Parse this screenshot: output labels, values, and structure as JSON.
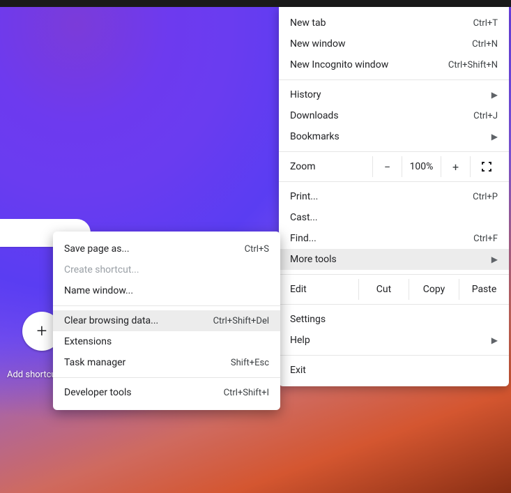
{
  "shortcut": {
    "plus": "+",
    "label": "Add shortcut"
  },
  "menu": {
    "new_tab": {
      "label": "New tab",
      "shortcut": "Ctrl+T"
    },
    "new_window": {
      "label": "New window",
      "shortcut": "Ctrl+N"
    },
    "new_incognito": {
      "label": "New Incognito window",
      "shortcut": "Ctrl+Shift+N"
    },
    "history": {
      "label": "History"
    },
    "downloads": {
      "label": "Downloads",
      "shortcut": "Ctrl+J"
    },
    "bookmarks": {
      "label": "Bookmarks"
    },
    "zoom_label": "Zoom",
    "zoom_value": "100%",
    "zoom_minus": "−",
    "zoom_plus": "+",
    "print": {
      "label": "Print...",
      "shortcut": "Ctrl+P"
    },
    "cast": {
      "label": "Cast..."
    },
    "find": {
      "label": "Find...",
      "shortcut": "Ctrl+F"
    },
    "more_tools": {
      "label": "More tools"
    },
    "edit_label": "Edit",
    "cut": "Cut",
    "copy": "Copy",
    "paste": "Paste",
    "settings": {
      "label": "Settings"
    },
    "help": {
      "label": "Help"
    },
    "exit": {
      "label": "Exit"
    },
    "chevron": "▶"
  },
  "submenu": {
    "save_page": {
      "label": "Save page as...",
      "shortcut": "Ctrl+S"
    },
    "create_shortcut": {
      "label": "Create shortcut..."
    },
    "name_window": {
      "label": "Name window..."
    },
    "clear_browsing": {
      "label": "Clear browsing data...",
      "shortcut": "Ctrl+Shift+Del"
    },
    "extensions": {
      "label": "Extensions"
    },
    "task_manager": {
      "label": "Task manager",
      "shortcut": "Shift+Esc"
    },
    "developer_tools": {
      "label": "Developer tools",
      "shortcut": "Ctrl+Shift+I"
    }
  }
}
